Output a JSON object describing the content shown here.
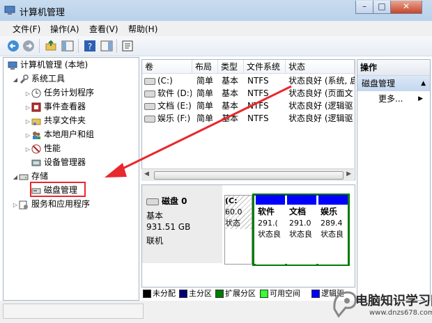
{
  "window": {
    "title": "计算机管理"
  },
  "menu": [
    "文件(F)",
    "操作(A)",
    "查看(V)",
    "帮助(H)"
  ],
  "tree": {
    "root": "计算机管理 (本地)",
    "system_tools": "系统工具",
    "items": [
      "任务计划程序",
      "事件查看器",
      "共享文件夹",
      "本地用户和组",
      "性能",
      "设备管理器"
    ],
    "storage": "存储",
    "disk_management": "磁盘管理",
    "services": "服务和应用程序"
  },
  "volume_list": {
    "columns": [
      "卷",
      "布局",
      "类型",
      "文件系统",
      "状态"
    ],
    "rows": [
      {
        "volume": "(C:)",
        "layout": "简单",
        "type": "基本",
        "fs": "NTFS",
        "status": "状态良好 (系统, 启"
      },
      {
        "volume": "软件 (D:)",
        "layout": "简单",
        "type": "基本",
        "fs": "NTFS",
        "status": "状态良好 (页面文"
      },
      {
        "volume": "文档 (E:)",
        "layout": "简单",
        "type": "基本",
        "fs": "NTFS",
        "status": "状态良好 (逻辑驱"
      },
      {
        "volume": "娱乐 (F:)",
        "layout": "简单",
        "type": "基本",
        "fs": "NTFS",
        "status": "状态良好 (逻辑驱"
      }
    ]
  },
  "disk": {
    "name": "磁盘 0",
    "type": "基本",
    "size": "931.51 GB",
    "status": "联机",
    "partitions": [
      {
        "name": "(C:",
        "size": "60.0",
        "status": "状态"
      },
      {
        "name": "软件",
        "size": "291.(",
        "status": "状态良"
      },
      {
        "name": "文档",
        "size": "291.0",
        "status": "状态良"
      },
      {
        "name": "娱乐",
        "size": "289.4",
        "status": "状态良"
      }
    ]
  },
  "legend": [
    {
      "label": "未分配",
      "color": "#000000"
    },
    {
      "label": "主分区",
      "color": "#00007b"
    },
    {
      "label": "扩展分区",
      "color": "#007b00"
    },
    {
      "label": "可用空间",
      "color": "#33ff33"
    },
    {
      "label": "逻辑驱",
      "color": "#0000ff"
    }
  ],
  "actions": {
    "header": "操作",
    "section": "磁盘管理",
    "more": "更多..."
  },
  "watermark": {
    "site": "电脑知识学习网",
    "url": "www.dnzs678.com"
  },
  "colors": {
    "highlight_red": "#e8282c",
    "primary": "#00007b",
    "logical": "#0000ff",
    "extended": "#007b00"
  }
}
